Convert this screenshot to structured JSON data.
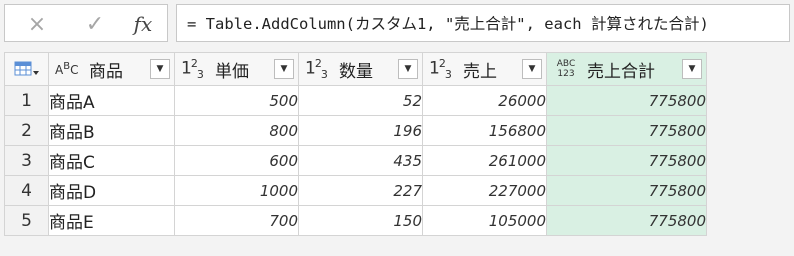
{
  "formula_bar": {
    "cancel_icon": "×",
    "confirm_icon": "✓",
    "fx_label": "fx",
    "formula": "= Table.AddColumn(カスタム1, \"売上合計\", each 計算された合計)"
  },
  "grid": {
    "columns": [
      {
        "type_icon": "ABC",
        "label": "商品"
      },
      {
        "type_icon": "123",
        "label": "単価"
      },
      {
        "type_icon": "123",
        "label": "数量"
      },
      {
        "type_icon": "123",
        "label": "売上"
      },
      {
        "type_icon": "ABC123",
        "label": "売上合計"
      }
    ],
    "rows": [
      {
        "num": "1",
        "cells": [
          "商品A",
          "500",
          "52",
          "26000",
          "775800"
        ]
      },
      {
        "num": "2",
        "cells": [
          "商品B",
          "800",
          "196",
          "156800",
          "775800"
        ]
      },
      {
        "num": "3",
        "cells": [
          "商品C",
          "600",
          "435",
          "261000",
          "775800"
        ]
      },
      {
        "num": "4",
        "cells": [
          "商品D",
          "1000",
          "227",
          "227000",
          "775800"
        ]
      },
      {
        "num": "5",
        "cells": [
          "商品E",
          "700",
          "150",
          "105000",
          "775800"
        ]
      }
    ]
  },
  "colors": {
    "selected_column": "#d9f0e3",
    "border": "#d4d4d4",
    "background": "#f3f3f3"
  }
}
